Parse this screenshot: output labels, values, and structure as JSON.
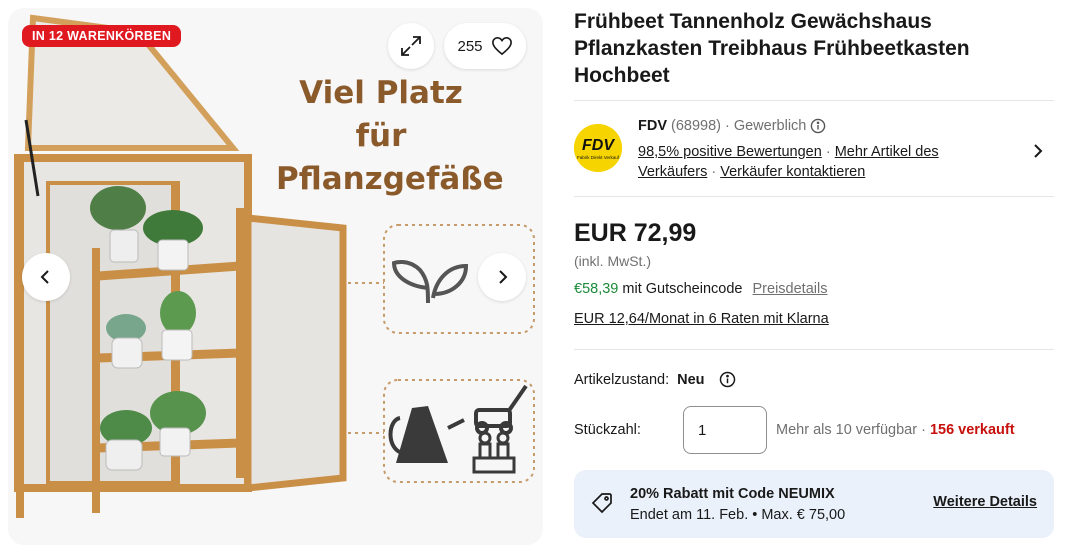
{
  "gallery": {
    "badge": "IN 12 WARENKÖRBEN",
    "watch_count": "255",
    "headline_line1": "Viel Platz für",
    "headline_line2": "Pflanzgefäße",
    "icons": [
      "expand-icon",
      "heart-icon",
      "chevron-left-icon",
      "chevron-right-icon"
    ]
  },
  "product": {
    "title": "Frühbeet Tannenholz Gewächshaus Pflanzkasten Treibhaus Frühbeetkasten Hochbeet"
  },
  "seller": {
    "name": "FDV",
    "rating_count": "(68998)",
    "separator": "·",
    "type": "Gewerblich",
    "logo_text": "FDV",
    "logo_subtext": "Fabrik Direkt Verkauf",
    "positive": "98,5% positive Bewertungen",
    "more_items": "Mehr Artikel des Verkäufers",
    "contact": "Verkäufer kontaktieren"
  },
  "pricing": {
    "price": "EUR 72,99",
    "vat": "(inkl. MwSt.)",
    "coupon_price": "€58,39",
    "coupon_text": " mit Gutscheincode",
    "price_details": "Preisdetails",
    "klarna": "EUR 12,64/Monat in 6 Raten mit Klarna"
  },
  "condition": {
    "label": "Artikelzustand:",
    "value": "Neu"
  },
  "quantity": {
    "label": "Stückzahl:",
    "value": "1",
    "available": "Mehr als 10 verfügbar",
    "separator": " · ",
    "sold": "156 verkauft"
  },
  "promo": {
    "title": "20% Rabatt mit Code NEUMIX",
    "subtitle": "Endet am 11. Feb. • Max. € 75,00",
    "link": "Weitere Details"
  },
  "colors": {
    "badge": "#e0181f",
    "price_green": "#1b8a3a",
    "sold_red": "#c7110c",
    "promo_bg": "#eaf1fb",
    "logo_yellow": "#f6d400"
  }
}
